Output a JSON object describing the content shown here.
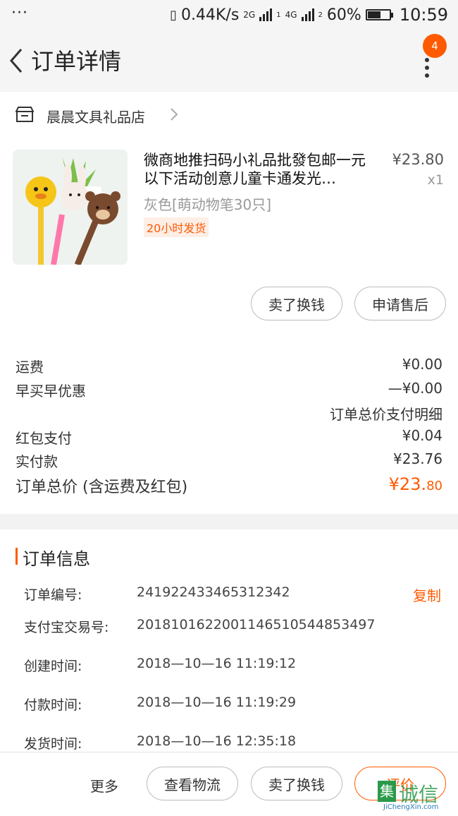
{
  "status_bar": {
    "dots": "···",
    "net_speed": "0.44K/s",
    "net_2g": "2G",
    "net_4g": "4G",
    "sim1": "1",
    "sim2": "2",
    "battery": "60%",
    "time": "10:59",
    "battery_level": 0.6
  },
  "header": {
    "title": "订单详情",
    "badge": "4"
  },
  "shop": {
    "name": "晨晨文具礼品店"
  },
  "product": {
    "title": "微商地推扫码小礼品批發包邮一元以下活动创意儿童卡通发光…",
    "price": "¥23.80",
    "qty": "x1",
    "spec": "灰色[萌动物笔30只]",
    "tag": "20小时发货"
  },
  "actions": {
    "sell": "卖了换钱",
    "after_sale": "申请售后"
  },
  "fees": {
    "shipping_label": "运费",
    "shipping_value": "¥0.00",
    "early_label": "早买早优惠",
    "early_value": "—¥0.00",
    "detail_link": "订单总价支付明细",
    "redpack_label": "红包支付",
    "redpack_value": "¥0.04",
    "paid_label": "实付款",
    "paid_value": "¥23.76",
    "total_label": "订单总价 (含运费及红包)",
    "total_value_big": "¥23.",
    "total_value_small": "80"
  },
  "order_info": {
    "title": "订单信息",
    "copy": "复制",
    "rows": [
      {
        "k": "订单编号:",
        "v": "241922433465312342"
      },
      {
        "k": "支付宝交易号:",
        "v": "2018101622001146510544853497"
      },
      {
        "k": "创建时间:",
        "v": "2018—10—16  11:19:12"
      },
      {
        "k": "付款时间:",
        "v": "2018—10—16  11:19:29"
      },
      {
        "k": "发货时间:",
        "v": "2018—10—16  12:35:18"
      }
    ]
  },
  "bottom_bar": {
    "more": "更多",
    "logistics": "查看物流",
    "sell": "卖了换钱",
    "review": "评价"
  },
  "watermark": {
    "text": "诚信",
    "sub": "JiChengXin.com",
    "mark": "集"
  },
  "colors": {
    "accent": "#ff5a00",
    "bg": "#f2f2f2"
  }
}
